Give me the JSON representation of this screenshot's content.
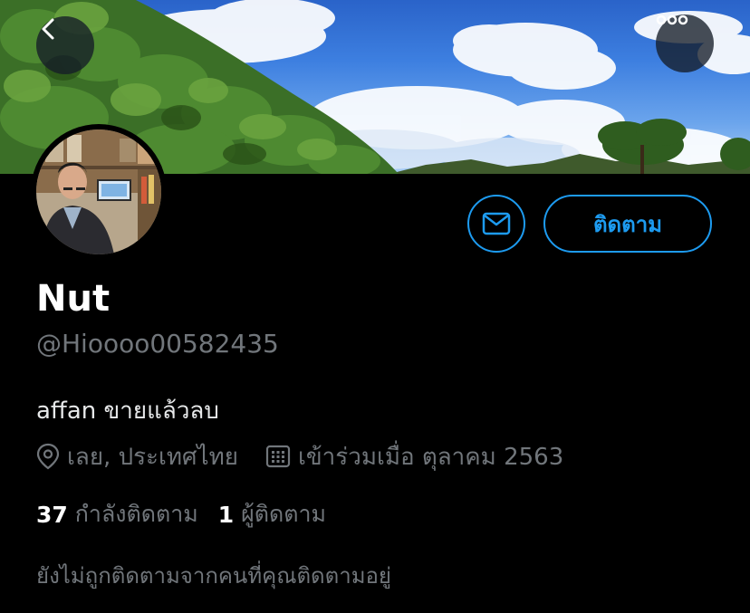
{
  "header": {
    "back_icon": "chevron-left-icon",
    "more_icon": "ellipsis-icon"
  },
  "profile": {
    "name": "Nut",
    "handle": "@Hioooo00582435",
    "bio": "affan ขายแล้วลบ",
    "location": "เลย, ประเทศไทย",
    "joined": "เข้าร่วมเมื่อ ตุลาคม 2563",
    "following_count": "37",
    "following_label": "กำลังติดตาม",
    "followers_count": "1",
    "followers_label": "ผู้ติดตาม",
    "mutual_note": "ยังไม่ถูกติดตามจากคนที่คุณติดตามอยู่"
  },
  "actions": {
    "follow_label": "ติดตาม",
    "message_icon": "mail-icon"
  },
  "colors": {
    "accent": "#1d9bf0",
    "background": "#000000",
    "secondary_text": "#71767b",
    "primary_text": "#ffffff"
  }
}
